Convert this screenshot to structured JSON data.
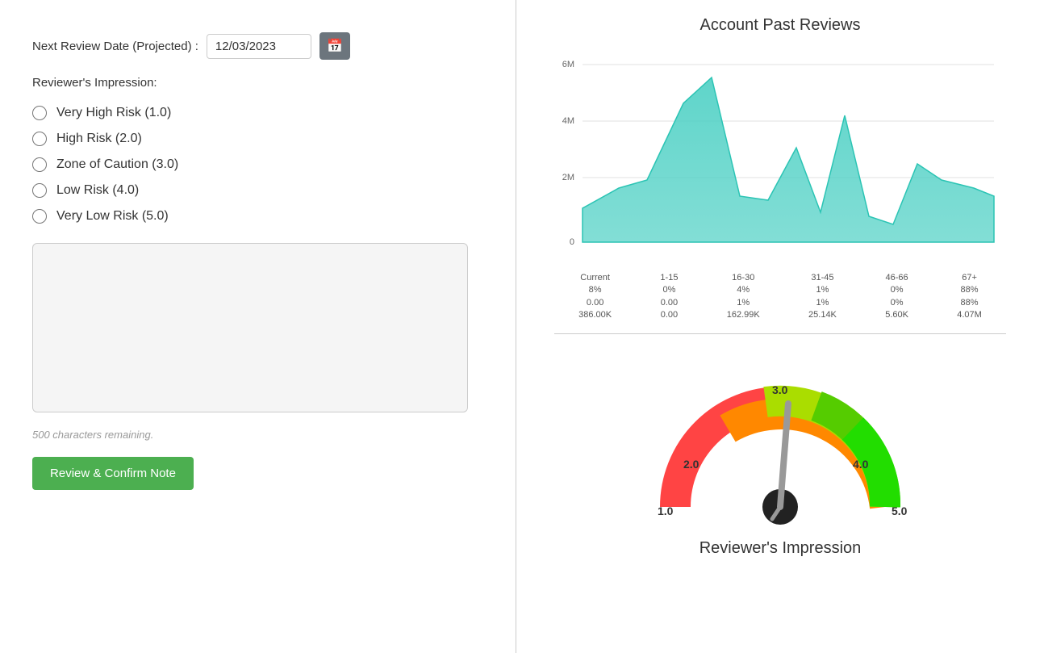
{
  "left": {
    "next_review_label": "Next Review Date (Projected) :",
    "date_value": "12/03/2023",
    "calendar_icon": "📅",
    "impression_label": "Reviewer's Impression:",
    "radio_options": [
      {
        "id": "vhr",
        "label": "Very High Risk (1.0)",
        "value": "1.0"
      },
      {
        "id": "hr",
        "label": "High Risk (2.0)",
        "value": "2.0"
      },
      {
        "id": "zoc",
        "label": "Zone of Caution (3.0)",
        "value": "3.0"
      },
      {
        "id": "lr",
        "label": "Low Risk (4.0)",
        "value": "4.0"
      },
      {
        "id": "vlr",
        "label": "Very Low Risk (5.0)",
        "value": "5.0"
      }
    ],
    "textarea_placeholder": "",
    "chars_remaining": "500 characters remaining.",
    "confirm_button_label": "Review & Confirm Note"
  },
  "right": {
    "chart_title": "Account Past Reviews",
    "chart_columns": [
      {
        "label": "Current",
        "pct": "8%",
        "val": "0.00",
        "amount": "386.00K"
      },
      {
        "label": "1-15",
        "pct": "0%",
        "val": "0.00",
        "amount": "0.00"
      },
      {
        "label": "16-30",
        "pct": "4%",
        "val": "1%",
        "amount": "162.99K"
      },
      {
        "label": "31-45",
        "pct": "1%",
        "val": "1%",
        "amount": "25.14K"
      },
      {
        "label": "46-66",
        "pct": "0%",
        "val": "0%",
        "amount": "5.60K"
      },
      {
        "label": "67+",
        "pct": "88%",
        "val": "88%",
        "amount": "4.07M"
      }
    ],
    "y_labels": [
      "0",
      "2M",
      "4M",
      "6M"
    ],
    "gauge_title": "Reviewer's Impression",
    "gauge_labels": {
      "left_far": "1.0",
      "left_mid": "2.0",
      "top": "3.0",
      "right_mid": "4.0",
      "right_far": "5.0"
    }
  }
}
